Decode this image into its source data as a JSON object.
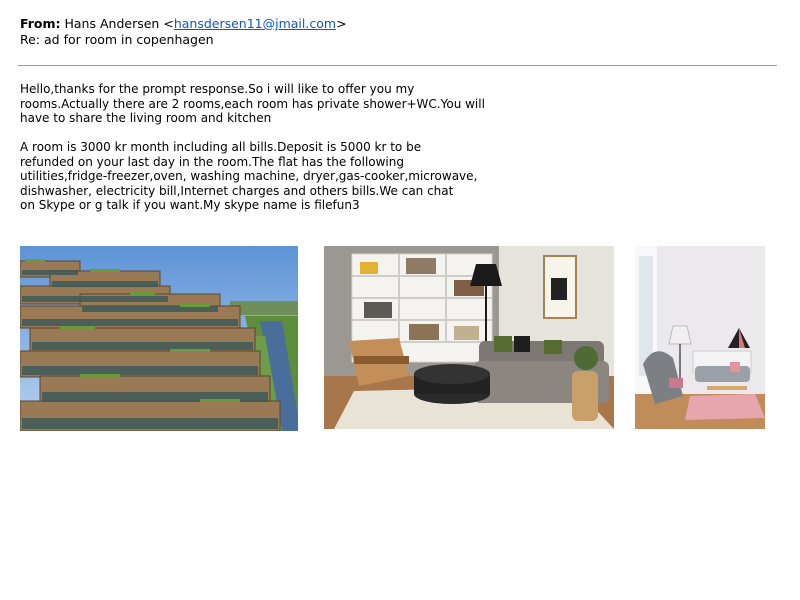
{
  "email": {
    "from_label": "From:",
    "from_name": "Hans Andersen",
    "from_address": "hansdersen11@jmail.com",
    "subject": "Re: ad for room in copenhagen",
    "paragraphs": [
      "Hello,thanks for the prompt response.So i will like to offer you my\nrooms.Actually there are 2 rooms,each room has private shower+WC.You will\nhave to share the living room and kitchen",
      "  A room is 3000 kr month including all bills.Deposit is 5000 kr to be\nrefunded on your last day in the room.The flat has the following\nutilities,fridge-freezer,oven, washing machine, dryer,gas-cooker,microwave,\ndishwasher, electricity bill,Internet charges and others bills.We can chat\non Skype or g talk if you want.My skype name is filefun3"
    ]
  },
  "attachments": [
    {
      "subject": "stepped apartment building beside a canal"
    },
    {
      "subject": "living room with grey sofa and white bookshelf"
    },
    {
      "subject": "bright living room with grey armchair and pink rug"
    }
  ],
  "colors": {
    "link": "#1155cc",
    "divider": "#9a9a9a"
  }
}
